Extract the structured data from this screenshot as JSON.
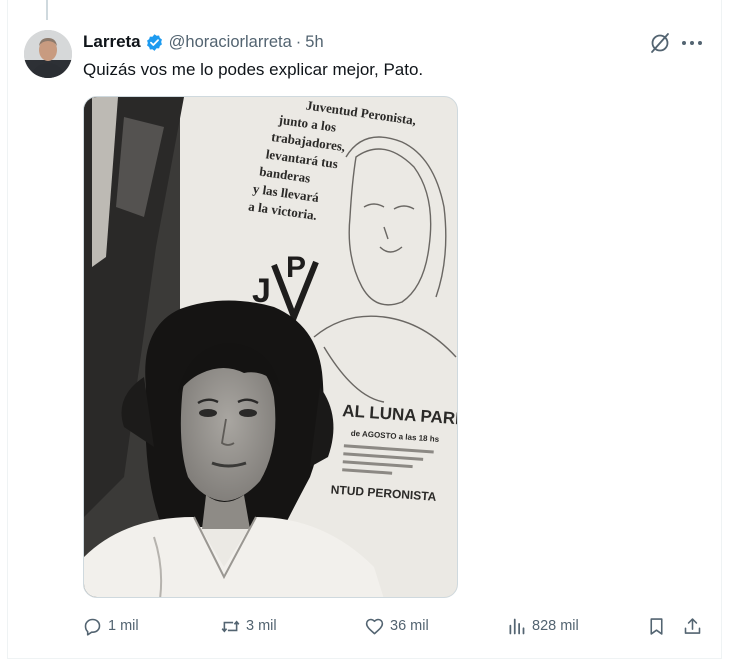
{
  "tweet": {
    "display_name": "Larreta",
    "handle": "@horaciorlarreta",
    "separator": "·",
    "time": "5h",
    "text": "Quizás vos me lo podes explicar mejor, Pato.",
    "verified": true
  },
  "poster": {
    "lines": [
      "Juventud Peronista,",
      "junto a los",
      "trabajadores,",
      "levantará tus",
      "banderas",
      "y las llevará",
      "a la victoria."
    ],
    "emblem_j": "J",
    "emblem_p": "P",
    "venue": "AL LUNA PARK",
    "date_line": "de AGOSTO a las 18 hs",
    "footer": "NTUD PERONISTA"
  },
  "metrics": {
    "replies": "1 mil",
    "reposts": "3 mil",
    "likes": "36 mil",
    "views": "828 mil"
  },
  "colors": {
    "verified_blue": "#1d9bf0",
    "muted": "#536471",
    "text": "#0f1419"
  },
  "icons": [
    "reply-icon",
    "repost-icon",
    "like-icon",
    "views-icon",
    "bookmark-icon",
    "share-icon",
    "grok-icon",
    "more-icon",
    "verified-icon"
  ]
}
